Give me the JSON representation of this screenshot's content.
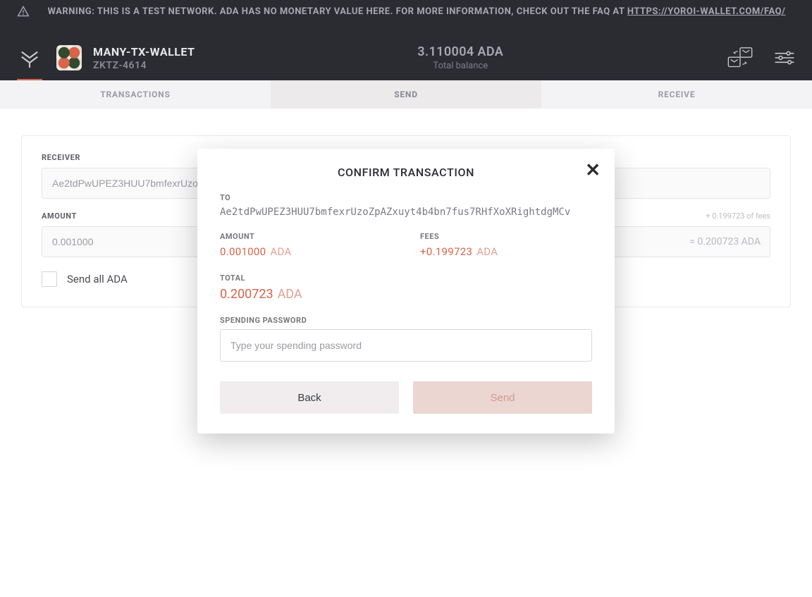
{
  "warning": {
    "prefix": "WARNING: THIS IS A TEST NETWORK. ADA HAS NO MONETARY VALUE HERE. FOR MORE INFORMATION, CHECK OUT THE FAQ AT ",
    "link_text": "HTTPS://YOROI-WALLET.COM/FAQ/"
  },
  "header": {
    "wallet_name": "MANY-TX-WALLET",
    "wallet_plate": "ZKTZ-4614",
    "balance_amount": "3.110004 ADA",
    "balance_label": "Total balance"
  },
  "tabs": {
    "transactions": "TRANSACTIONS",
    "send": "SEND",
    "receive": "RECEIVE",
    "active": "send"
  },
  "send_form": {
    "receiver_label": "RECEIVER",
    "receiver_value": "Ae2tdPwUPEZ3HUU7bmfexrUzo…",
    "amount_label": "AMOUNT",
    "amount_value": "0.001000",
    "fees_hint": "+ 0.199723 of fees",
    "amount_eq": "= 0.200723 ADA",
    "send_all_label": "Send all ADA"
  },
  "modal": {
    "title": "CONFIRM TRANSACTION",
    "to_label": "TO",
    "to_address": "Ae2tdPwUPEZ3HUU7bmfexrUzoZpAZxuyt4b4bn7fus7RHfXoXRightdgMCv",
    "amount_label": "AMOUNT",
    "amount_value": "0.001000",
    "amount_unit": "ADA",
    "fees_label": "FEES",
    "fees_value": "+0.199723",
    "fees_unit": "ADA",
    "total_label": "TOTAL",
    "total_value": "0.200723",
    "total_unit": "ADA",
    "password_label": "SPENDING PASSWORD",
    "password_placeholder": "Type your spending password",
    "back_label": "Back",
    "send_label": "Send"
  }
}
